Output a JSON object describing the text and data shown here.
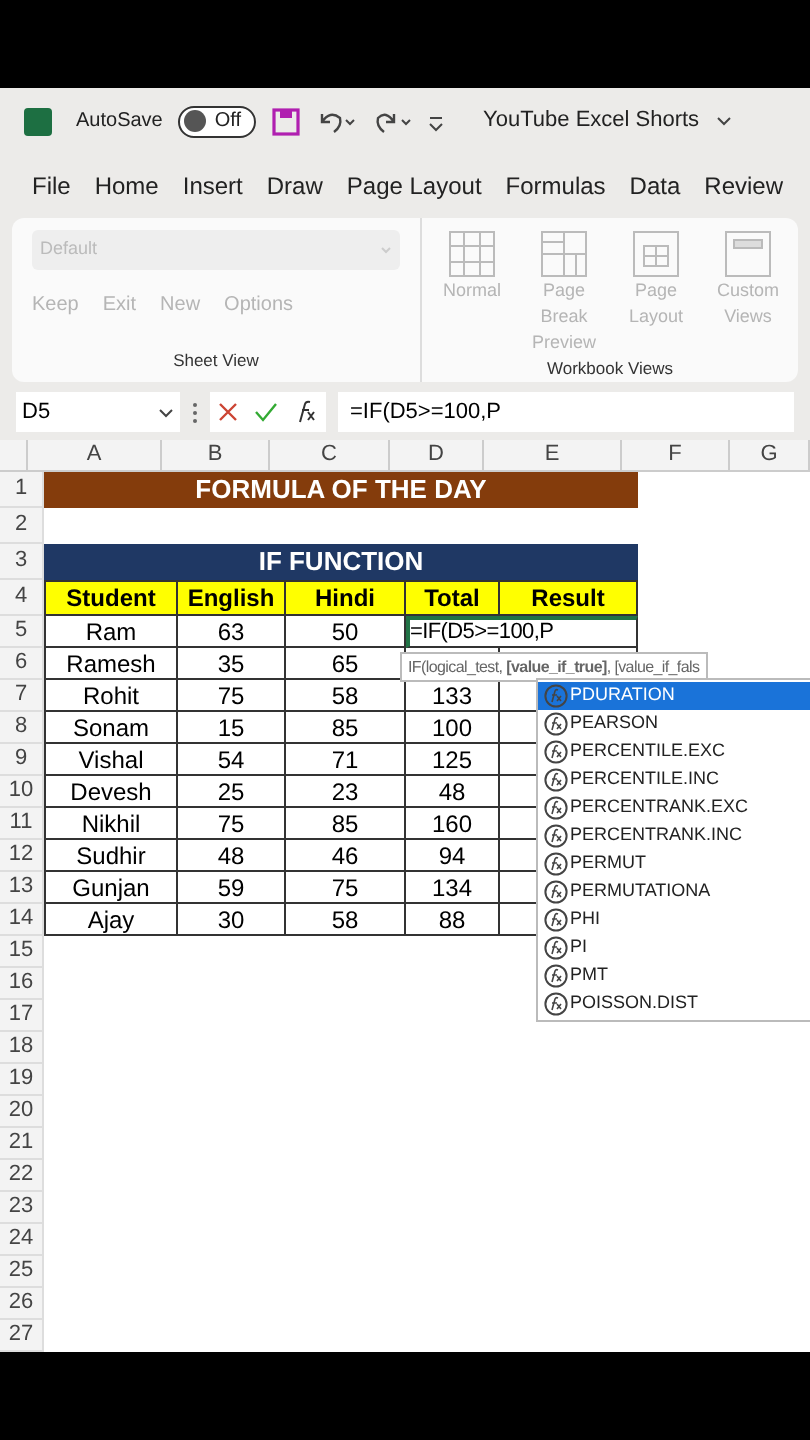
{
  "title_bar": {
    "autosave_label": "AutoSave",
    "autosave_toggle": {
      "label": "Off",
      "on": false
    },
    "document_title": "YouTube Excel Shorts"
  },
  "menu": [
    "File",
    "Home",
    "Insert",
    "Draw",
    "Page Layout",
    "Formulas",
    "Data",
    "Review"
  ],
  "ribbon": {
    "sheet_view": {
      "dropdown_placeholder": "Default",
      "buttons": [
        "Keep",
        "Exit",
        "New",
        "Options"
      ],
      "label": "Sheet View"
    },
    "workbook_views": {
      "buttons": [
        "Normal",
        "Page Break Preview",
        "Page Layout",
        "Custom Views"
      ],
      "label": "Workbook Views"
    }
  },
  "formula_bar": {
    "name_box": "D5",
    "formula": "=IF(D5>=100,P"
  },
  "columns": [
    "A",
    "B",
    "C",
    "D",
    "E",
    "F",
    "G"
  ],
  "row_numbers": [
    "1",
    "2",
    "3",
    "4",
    "5",
    "6",
    "7",
    "8",
    "9",
    "10",
    "11",
    "12",
    "13",
    "14",
    "15",
    "16",
    "17",
    "18",
    "19",
    "20",
    "21",
    "22",
    "23",
    "24",
    "25",
    "26",
    "27"
  ],
  "sheet": {
    "banner": "FORMULA OF THE DAY",
    "section_title": "IF FUNCTION",
    "headers": [
      "Student",
      "English",
      "Hindi",
      "Total",
      "Result"
    ],
    "rows": [
      [
        "Ram",
        "63",
        "50",
        "=IF(D5>=100,P"
      ],
      [
        "Ramesh",
        "35",
        "65"
      ],
      [
        "Rohit",
        "75",
        "58",
        "133"
      ],
      [
        "Sonam",
        "15",
        "85",
        "100"
      ],
      [
        "Vishal",
        "54",
        "71",
        "125"
      ],
      [
        "Devesh",
        "25",
        "23",
        "48"
      ],
      [
        "Nikhil",
        "75",
        "85",
        "160"
      ],
      [
        "Sudhir",
        "48",
        "46",
        "94"
      ],
      [
        "Gunjan",
        "59",
        "75",
        "134"
      ],
      [
        "Ajay",
        "30",
        "58",
        "88"
      ]
    ]
  },
  "tooltip": "IF(logical_test, **[value_if_true]**, [value_if_fals",
  "autocomplete": [
    {
      "label": "PDURATION",
      "selected": true
    },
    {
      "label": "PEARSON",
      "selected": false
    },
    {
      "label": "PERCENTILE.EXC",
      "selected": false
    },
    {
      "label": "PERCENTILE.INC",
      "selected": false
    },
    {
      "label": "PERCENTRANK.EXC",
      "selected": false
    },
    {
      "label": "PERCENTRANK.INC",
      "selected": false
    },
    {
      "label": "PERMUT",
      "selected": false
    },
    {
      "label": "PERMUTATIONA",
      "selected": false
    },
    {
      "label": "PHI",
      "selected": false
    },
    {
      "label": "PI",
      "selected": false
    },
    {
      "label": "PMT",
      "selected": false
    },
    {
      "label": "POISSON.DIST",
      "selected": false
    }
  ]
}
